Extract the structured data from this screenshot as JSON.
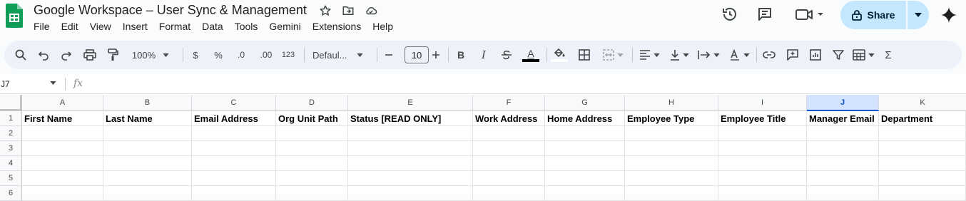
{
  "doc": {
    "title": "Google Workspace – User Sync & Management",
    "icons": [
      "star-icon",
      "move-to-folder-icon",
      "cloud-saved-icon"
    ]
  },
  "menu": [
    "File",
    "Edit",
    "View",
    "Insert",
    "Format",
    "Data",
    "Tools",
    "Gemini",
    "Extensions",
    "Help"
  ],
  "header_right": {
    "share_label": "Share",
    "icons": [
      "history-icon",
      "comments-icon",
      "meet-icon",
      "gemini-icon"
    ]
  },
  "toolbar": {
    "zoom": "100%",
    "currency": "$",
    "percent": "%",
    "decrease_decimal": ".0",
    "increase_decimal": ".00",
    "more_formats": "123",
    "font": "Defaul...",
    "font_size": "10",
    "bold": "B",
    "italic": "I",
    "text_color_letter": "A",
    "sum": "Σ",
    "accent": "#0b57d0"
  },
  "formula_bar": {
    "name_box": "J7",
    "fx": "fx"
  },
  "sheet": {
    "columns": [
      "A",
      "B",
      "C",
      "D",
      "E",
      "F",
      "G",
      "H",
      "I",
      "J",
      "K"
    ],
    "selected_column": "J",
    "rows": [
      "1",
      "2",
      "3",
      "4",
      "5",
      "6"
    ],
    "header_row": [
      "First Name",
      "Last Name",
      "Email Address",
      "Org Unit Path",
      "Status [READ ONLY]",
      "Work Address",
      "Home Address",
      "Employee Type",
      "Employee Title",
      "Manager Email",
      "Department"
    ]
  }
}
